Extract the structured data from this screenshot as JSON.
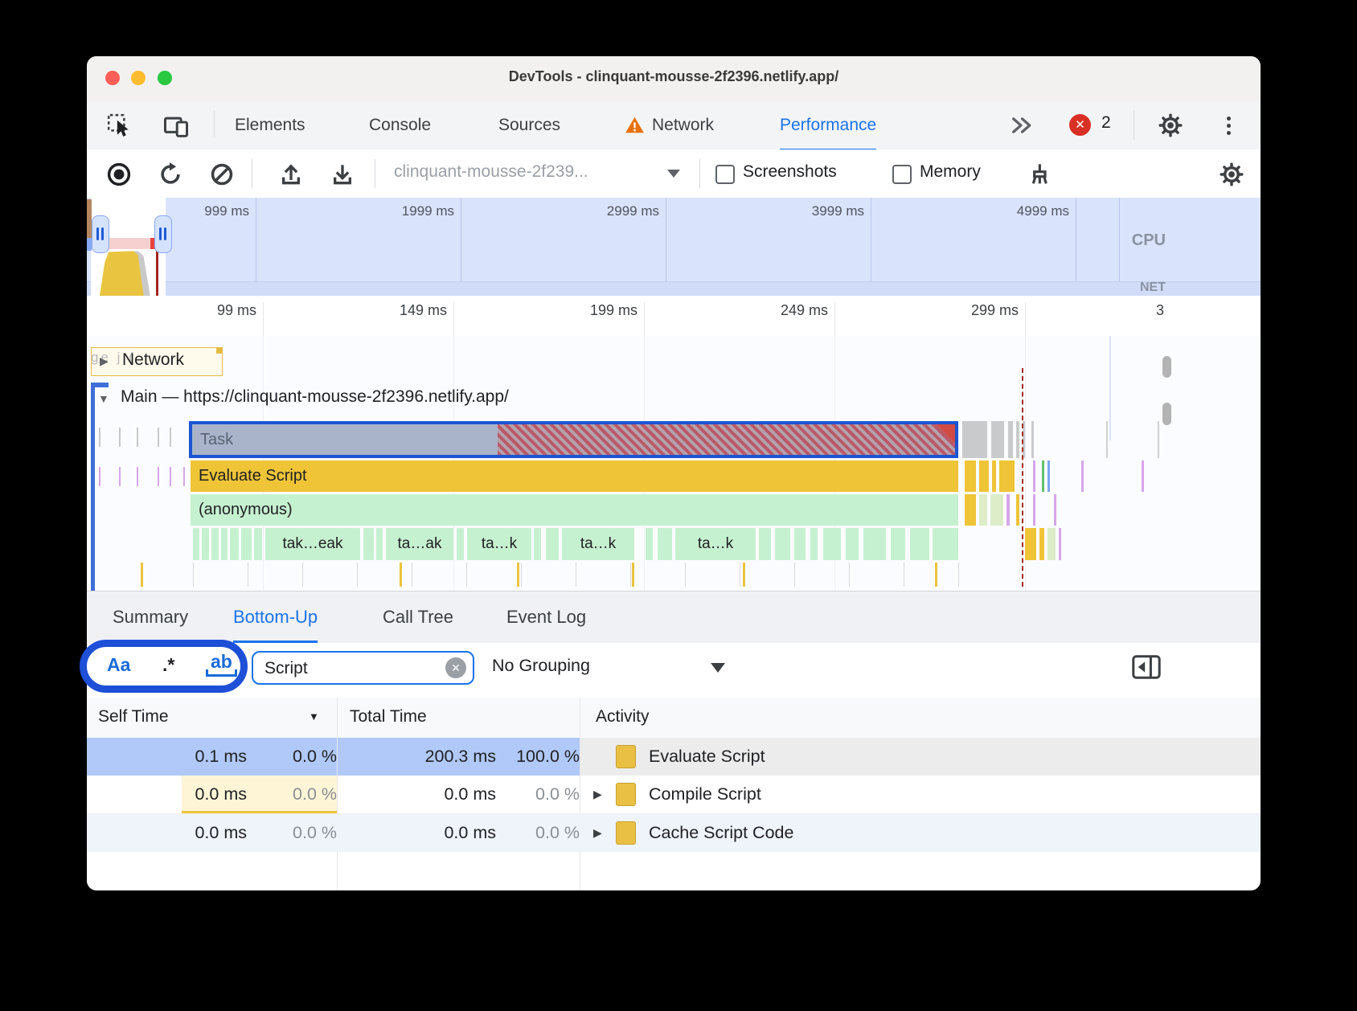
{
  "window": {
    "title": "DevTools - clinquant-mousse-2f2396.netlify.app/"
  },
  "tabbar": {
    "tabs": [
      "Elements",
      "Console",
      "Sources",
      "Network",
      "Performance"
    ],
    "selected": "Performance",
    "error_count": "2"
  },
  "toolbar": {
    "profile_label": "clinquant-mousse-2f239...",
    "screenshots_label": "Screenshots",
    "memory_label": "Memory"
  },
  "overview": {
    "ticks": [
      "999 ms",
      "1999 ms",
      "2999 ms",
      "3999 ms",
      "4999 ms"
    ],
    "cpu_label": "CPU",
    "net_label": "NET"
  },
  "ruler": {
    "ticks": [
      "99 ms",
      "149 ms",
      "199 ms",
      "249 ms",
      "299 ms"
    ],
    "clipped_tick": "3"
  },
  "tracks": {
    "network_label": "Network",
    "main_label": "Main — https://clinquant-mousse-2f2396.netlify.app/"
  },
  "flame": {
    "task_label": "Task",
    "evaluate_label": "Evaluate Script",
    "anonymous_label": "(anonymous)",
    "leaf_labels": [
      "tak…eak",
      "ta…ak",
      "ta…k",
      "ta…k",
      "ta…k"
    ]
  },
  "panel_tabs": {
    "tabs": [
      "Summary",
      "Bottom-Up",
      "Call Tree",
      "Event Log"
    ],
    "selected": "Bottom-Up"
  },
  "filterbar": {
    "match_case": "Aa",
    "regex": ".*",
    "match_word": "ab",
    "query": "Script",
    "grouping": "No Grouping"
  },
  "table": {
    "headers": {
      "self": "Self Time",
      "total": "Total Time",
      "activity": "Activity"
    },
    "rows": [
      {
        "self_ms": "0.1 ms",
        "self_pct": "0.0 %",
        "total_ms": "200.3 ms",
        "total_pct": "100.0 %",
        "activity": "Evaluate Script"
      },
      {
        "self_ms": "0.0 ms",
        "self_pct": "0.0 %",
        "total_ms": "0.0 ms",
        "total_pct": "0.0 %",
        "activity": "Compile Script"
      },
      {
        "self_ms": "0.0 ms",
        "self_pct": "0.0 %",
        "total_ms": "0.0 ms",
        "total_pct": "0.0 %",
        "activity": "Cache Script Code"
      }
    ]
  },
  "colors": {
    "accent_blue": "#1a73e8",
    "annotation_blue": "#1d4fd7",
    "selection_border_blue": "#1c55d3",
    "scripting_yellow": "#efc437",
    "function_green": "#c6f1d0",
    "error_red": "#d93025",
    "warning_orange": "#e8710a"
  }
}
